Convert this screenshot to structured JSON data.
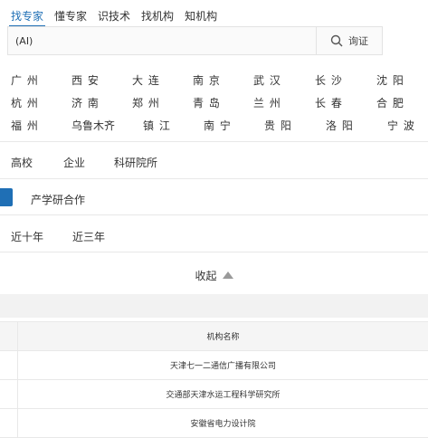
{
  "tabs": [
    "找专家",
    "懂专家",
    "识技术",
    "找机构",
    "知机构"
  ],
  "search": {
    "value": "(AI)",
    "button_label": "询证"
  },
  "cities": [
    [
      "广 州",
      "西 安",
      "大 连",
      "南 京",
      "武 汉",
      "长 沙",
      "沈 阳"
    ],
    [
      "杭 州",
      "济 南",
      "郑 州",
      "青 岛",
      "兰 州",
      "长 春",
      "合 肥"
    ],
    [
      "福 州",
      "乌鲁木齐",
      "镇 江",
      "南 宁",
      "贵 阳",
      "洛 阳",
      "宁 波"
    ]
  ],
  "institution_types": [
    "高校",
    "企业",
    "科研院所"
  ],
  "cooperation": "产学研合作",
  "time_ranges": [
    "近十年",
    "近三年"
  ],
  "collapse_label": "收起",
  "table": {
    "header": "机构名称",
    "rows": [
      "天津七一二通信广播有限公司",
      "交通部天津水运工程科学研究所",
      "安徽省电力设计院"
    ]
  },
  "colors": {
    "accent": "#1f6fb5"
  }
}
